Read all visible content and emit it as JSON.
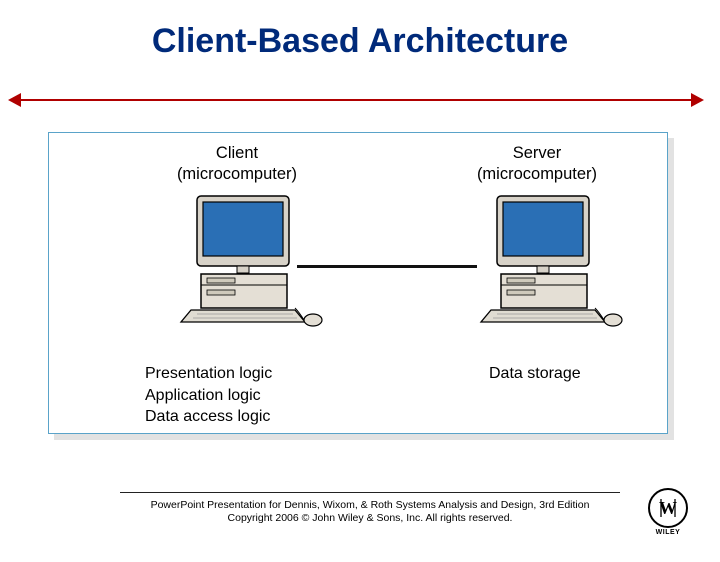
{
  "title": "Client-Based Architecture",
  "client": {
    "label_line1": "Client",
    "label_line2": "(microcomputer)",
    "func_line1": "Presentation logic",
    "func_line2": "Application logic",
    "func_line3": "Data access logic"
  },
  "server": {
    "label_line1": "Server",
    "label_line2": "(microcomputer)",
    "func_line1": "Data storage"
  },
  "footer": {
    "line1": "PowerPoint Presentation for Dennis, Wixom, & Roth Systems Analysis and Design, 3rd Edition",
    "line2": "Copyright 2006 © John Wiley & Sons, Inc.  All rights reserved."
  },
  "logo": {
    "glyph": "W",
    "brand": "WILEY"
  },
  "colors": {
    "title": "#002a7a",
    "divider": "#b00000",
    "box_border": "#5aa3c9",
    "monitor_screen": "#2a6fb5"
  }
}
